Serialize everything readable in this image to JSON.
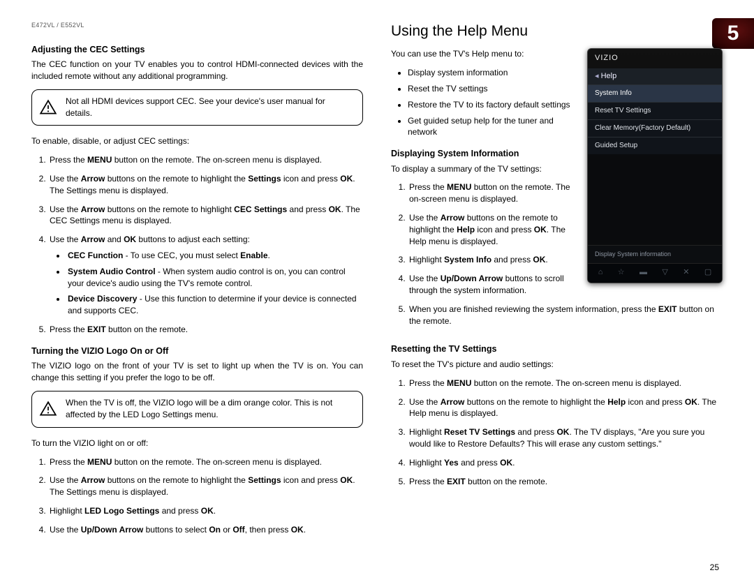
{
  "header": {
    "model": "E472VL / E552VL",
    "chapter_number": "5",
    "page_number": "25"
  },
  "left": {
    "h_cec": "Adjusting the CEC Settings",
    "p_cec": "The CEC function on your TV enables you to control HDMI-connected devices with the included remote without any additional programming.",
    "note_cec": "Not all HDMI devices support CEC. See your device's user manual for details.",
    "p_cec_enable": "To enable, disable, or adjust CEC settings:",
    "cec_steps": {
      "s1a": "Press the ",
      "s1b": "MENU",
      "s1c": " button on the remote. The on-screen menu is displayed.",
      "s2a": "Use the ",
      "s2b": "Arrow",
      "s2c": " buttons on the remote to highlight the ",
      "s2d": "Settings",
      "s2e": " icon and press ",
      "s2f": "OK",
      "s2g": ". The Settings menu is displayed.",
      "s3a": "Use the ",
      "s3b": "Arrow",
      "s3c": " buttons on the remote to highlight ",
      "s3d": "CEC Settings",
      "s3e": " and press ",
      "s3f": "OK",
      "s3g": ". The CEC Settings menu is displayed.",
      "s4a": "Use the ",
      "s4b": "Arrow",
      "s4c": " and ",
      "s4d": "OK",
      "s4e": " buttons to adjust each setting:",
      "b1a": "CEC Function",
      "b1b": " - To use CEC, you must select ",
      "b1c": "Enable",
      "b1d": ".",
      "b2a": "System Audio Control",
      "b2b": " - When system audio control is on, you can control your device's audio using the TV's remote control.",
      "b3a": "Device Discovery",
      "b3b": " - Use this function to determine if your device is connected and supports CEC.",
      "s5a": "Press the ",
      "s5b": "EXIT",
      "s5c": " button on the remote."
    },
    "h_logo": "Turning the VIZIO Logo On or Off",
    "p_logo": "The VIZIO logo on the front of your TV is set to light up when the TV is on. You can change this setting if you prefer the logo to be off.",
    "note_logo": "When the TV is off, the VIZIO logo will be a dim orange color. This is not affected by the LED Logo Settings menu.",
    "p_logo_turn": "To turn the VIZIO light on or off:",
    "logo_steps": {
      "s1a": "Press the ",
      "s1b": "MENU",
      "s1c": " button on the remote. The on-screen menu is displayed.",
      "s2a": "Use the ",
      "s2b": "Arrow",
      "s2c": " buttons on the remote to highlight the ",
      "s2d": "Settings",
      "s2e": " icon and press ",
      "s2f": "OK",
      "s2g": ". The Settings menu is displayed.",
      "s3a": "Highlight ",
      "s3b": "LED Logo Settings",
      "s3c": " and press ",
      "s3d": "OK",
      "s3e": ".",
      "s4a": "Use the ",
      "s4b": "Up/Down Arrow",
      "s4c": " buttons to select ",
      "s4d": "On",
      "s4e": " or ",
      "s4f": "Off",
      "s4g": ", then press ",
      "s4h": "OK",
      "s4i": "."
    }
  },
  "right": {
    "h_help": "Using the Help Menu",
    "p_help": "You can use the TV's Help menu to:",
    "help_bullets": {
      "b1": "Display system information",
      "b2": "Reset the TV settings",
      "b3": "Restore the TV to its factory default settings",
      "b4": "Get guided setup help for the tuner and network"
    },
    "h_sysinfo": "Displaying System Information",
    "p_sysinfo": "To display a summary of the TV settings:",
    "sys_steps": {
      "s1a": "Press the ",
      "s1b": "MENU",
      "s1c": " button on the remote. The on-screen menu is displayed.",
      "s2a": "Use the ",
      "s2b": "Arrow",
      "s2c": " buttons on the remote to highlight the ",
      "s2d": "Help",
      "s2e": " icon and press ",
      "s2f": "OK",
      "s2g": ". The Help menu is displayed.",
      "s3a": "Highlight ",
      "s3b": "System Info",
      "s3c": " and press ",
      "s3d": "OK",
      "s3e": ".",
      "s4a": "Use the ",
      "s4b": "Up/Down Arrow",
      "s4c": " buttons to scroll through the system information.",
      "s5a": "When you are finished reviewing the system information, press the ",
      "s5b": "EXIT",
      "s5c": " button on the remote."
    },
    "h_reset": "Resetting the TV Settings",
    "p_reset": "To reset the TV's picture and audio settings:",
    "reset_steps": {
      "s1a": "Press the ",
      "s1b": "MENU",
      "s1c": " button on the remote. The on-screen menu is displayed.",
      "s2a": "Use the ",
      "s2b": "Arrow",
      "s2c": " buttons on the remote to highlight the ",
      "s2d": "Help",
      "s2e": " icon and press ",
      "s2f": "OK",
      "s2g": ". The Help menu is displayed.",
      "s3a": "Highlight ",
      "s3b": "Reset TV Settings",
      "s3c": " and press ",
      "s3d": "OK",
      "s3e": ". The TV displays, \"Are you sure you would like to Restore Defaults? This will erase any custom settings.\"",
      "s4a": "Highlight ",
      "s4b": "Yes",
      "s4c": " and press ",
      "s4d": "OK",
      "s4e": ".",
      "s5a": "Press the ",
      "s5b": "EXIT",
      "s5c": " button on the remote."
    },
    "tv": {
      "brand": "VIZIO",
      "head": "Help",
      "items": [
        "System Info",
        "Reset TV Settings",
        "Clear Memory(Factory Default)",
        "Guided Setup"
      ],
      "hint": "Display System information",
      "nav": [
        "⌂",
        "☆",
        "▬",
        "▽",
        "✕",
        "▢"
      ]
    }
  }
}
